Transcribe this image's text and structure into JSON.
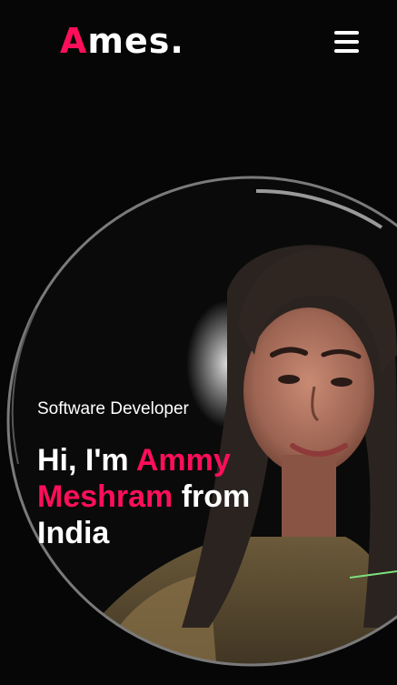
{
  "header": {
    "logo_accent": "A",
    "logo_rest": "mes.",
    "menu_icon": "hamburger-menu-icon"
  },
  "hero": {
    "subtitle": "Software Developer",
    "greeting": "Hi, I'm",
    "name_first": "Ammy",
    "name_last": "Meshram",
    "from": "from",
    "country": "India",
    "photo_icon": "profile-photo"
  },
  "colors": {
    "background": "#060606",
    "accent": "#ff0f5a",
    "text": "#ffffff"
  }
}
